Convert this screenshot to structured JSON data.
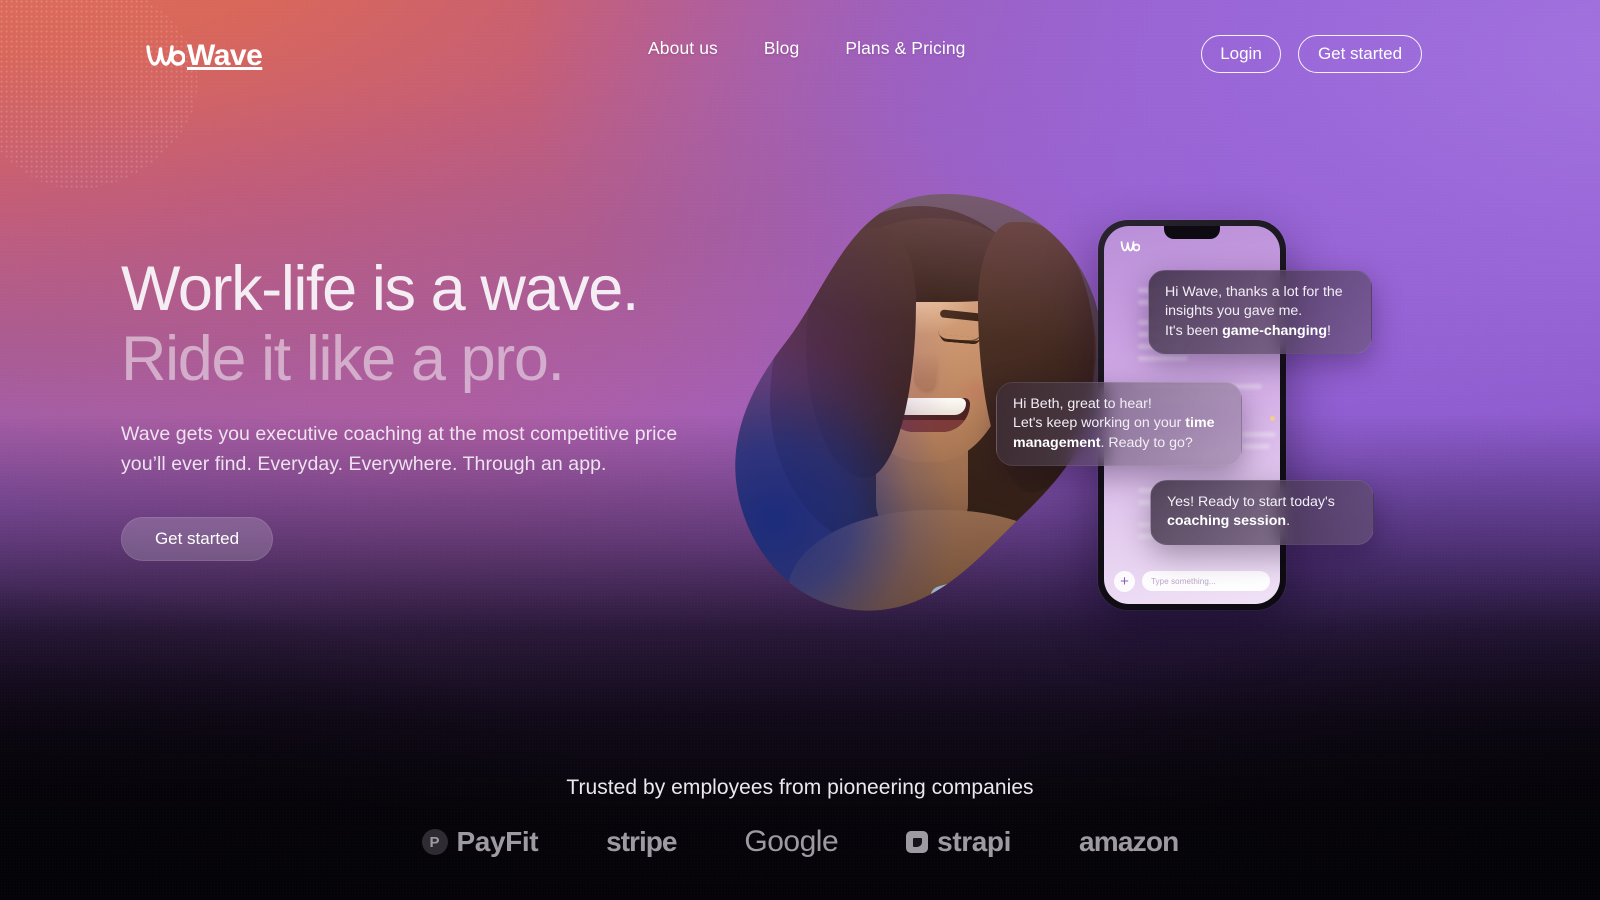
{
  "brand": {
    "name": "Wave",
    "logo_icon": "wave-w-mark"
  },
  "nav": {
    "links": [
      {
        "label": "About us"
      },
      {
        "label": "Blog"
      },
      {
        "label": "Plans & Pricing"
      }
    ],
    "login_label": "Login",
    "get_started_label": "Get started"
  },
  "hero": {
    "headline_line1": "Work-life is a wave.",
    "headline_line2": "Ride it like a pro.",
    "subhead": "Wave gets you executive coaching at the most competitive price you’ll ever find. Everyday. Everywhere. Through an app.",
    "cta_label": "Get started"
  },
  "phone": {
    "logo_icon": "wave-w-mark",
    "input_placeholder": "Type something...",
    "plus_label": "+",
    "messages": [
      {
        "id": "msg-1",
        "side": "right",
        "line1": "Hi Wave, thanks a lot for the",
        "line2": "insights you gave me.",
        "line3_pre": "It's been ",
        "line3_bold": "game-changing",
        "line3_post": "!"
      },
      {
        "id": "msg-2",
        "side": "left",
        "line1": "Hi Beth, great to hear!",
        "line2_pre": "Let's keep working on your ",
        "line2_bold": "time",
        "line3_bold": "management",
        "line3_post": ". Ready to go?"
      },
      {
        "id": "msg-3",
        "side": "right",
        "line1": "Yes! Ready to start today's",
        "line2_bold": "coaching session",
        "line2_post": "."
      }
    ]
  },
  "trusted": {
    "title": "Trusted by employees from pioneering companies",
    "logos": [
      {
        "name": "PayFit",
        "icon": "payfit-badge-icon"
      },
      {
        "name": "stripe",
        "icon": ""
      },
      {
        "name": "Google",
        "icon": ""
      },
      {
        "name": "strapi",
        "icon": "strapi-badge-icon"
      },
      {
        "name": "amazon",
        "icon": ""
      }
    ]
  },
  "colors": {
    "bg_warm": "#d9675a",
    "bg_magenta": "#a95e96",
    "bg_purple": "#9a62d4",
    "bg_dark": "#07050a",
    "text_light": "#f4eef4",
    "phone_screen": "#c79ce0",
    "blob_blue": "#1a2a80"
  }
}
